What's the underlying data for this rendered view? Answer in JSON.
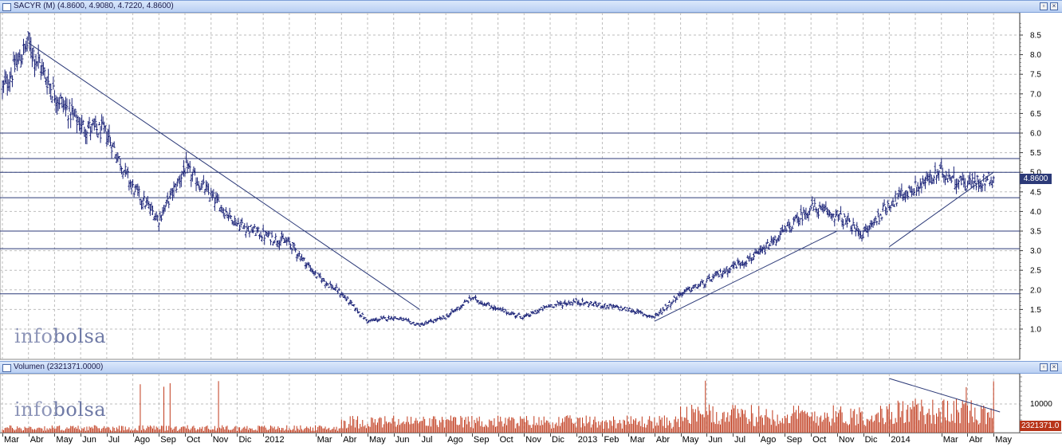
{
  "price_panel": {
    "title": "SACYR (M) (4.8600, 4.9080, 4.7220, 4.8600)",
    "last_value_label": "4.8600",
    "watermark_a": "info",
    "watermark_b": "bolsa"
  },
  "volume_panel": {
    "title": "Volumen (2321371.0000)",
    "last_value_label": "2321371.0",
    "axis_label": "10000",
    "watermark_a": "info",
    "watermark_b": "bolsa"
  },
  "colors": {
    "price_bars": "#1c2478",
    "volume_bars": "#c0391b",
    "horizontal_levels": "#2c3a78",
    "trendlines": "#2c3a78",
    "grid": "#bdbdbd",
    "panel_title_bg": "#c9dbf6"
  },
  "chart_data": [
    {
      "type": "ohlc",
      "title": "SACYR (M) (4.8600, 4.9080, 4.7220, 4.8600)",
      "y_ticks": [
        "1.0",
        "1.5",
        "2.0",
        "2.5",
        "3.0",
        "3.5",
        "4.0",
        "4.5",
        "5.0",
        "5.5",
        "6.0",
        "6.5",
        "7.0",
        "7.5",
        "8.0",
        "8.5"
      ],
      "ylim": [
        0.4,
        8.9
      ],
      "grid": true,
      "x_tick_labels": [
        "Mar",
        "Abr",
        "May",
        "Jun",
        "Jul",
        "Ago",
        "Sep",
        "Oct",
        "Nov",
        "Dic",
        "2012",
        "Mar",
        "Abr",
        "May",
        "Jun",
        "Jul",
        "Ago",
        "Sep",
        "Oct",
        "Nov",
        "Dic",
        "2013",
        "Feb",
        "Mar",
        "Abr",
        "May",
        "Jun",
        "Jul",
        "Ago",
        "Sep",
        "Oct",
        "Nov",
        "Dic",
        "2014",
        "Mar",
        "Abr",
        "May"
      ],
      "period": [
        "2011-03",
        "2014-05"
      ],
      "last": {
        "open": 4.86,
        "high": 4.908,
        "low": 4.722,
        "close": 4.86
      },
      "price_path": [
        {
          "date": "2011-03",
          "close": 7.1
        },
        {
          "date": "2011-04",
          "close": 8.3
        },
        {
          "date": "2011-05",
          "close": 7.0
        },
        {
          "date": "2011-06",
          "close": 6.2
        },
        {
          "date": "2011-07",
          "close": 6.0
        },
        {
          "date": "2011-08",
          "close": 4.6
        },
        {
          "date": "2011-09",
          "close": 3.8
        },
        {
          "date": "2011-10",
          "close": 5.1
        },
        {
          "date": "2011-11",
          "close": 4.4
        },
        {
          "date": "2011-12",
          "close": 3.7
        },
        {
          "date": "2012-01",
          "close": 3.4
        },
        {
          "date": "2012-02",
          "close": 3.2
        },
        {
          "date": "2012-03",
          "close": 2.4
        },
        {
          "date": "2012-04",
          "close": 1.9
        },
        {
          "date": "2012-05",
          "close": 1.2
        },
        {
          "date": "2012-06",
          "close": 1.3
        },
        {
          "date": "2012-07",
          "close": 1.1
        },
        {
          "date": "2012-08",
          "close": 1.3
        },
        {
          "date": "2012-09",
          "close": 1.8
        },
        {
          "date": "2012-10",
          "close": 1.5
        },
        {
          "date": "2012-11",
          "close": 1.3
        },
        {
          "date": "2012-12",
          "close": 1.6
        },
        {
          "date": "2013-01",
          "close": 1.7
        },
        {
          "date": "2013-02",
          "close": 1.6
        },
        {
          "date": "2013-03",
          "close": 1.5
        },
        {
          "date": "2013-04",
          "close": 1.3
        },
        {
          "date": "2013-05",
          "close": 1.9
        },
        {
          "date": "2013-06",
          "close": 2.2
        },
        {
          "date": "2013-07",
          "close": 2.6
        },
        {
          "date": "2013-08",
          "close": 2.9
        },
        {
          "date": "2013-09",
          "close": 3.5
        },
        {
          "date": "2013-10",
          "close": 4.1
        },
        {
          "date": "2013-11",
          "close": 3.9
        },
        {
          "date": "2013-12",
          "close": 3.4
        },
        {
          "date": "2014-01",
          "close": 4.2
        },
        {
          "date": "2014-02",
          "close": 4.6
        },
        {
          "date": "2014-03",
          "close": 5.0
        },
        {
          "date": "2014-04",
          "close": 4.7
        },
        {
          "date": "2014-05",
          "close": 4.86
        }
      ],
      "horizontal_levels": [
        1.9,
        3.05,
        3.5,
        4.35,
        5.0,
        5.35,
        6.0
      ],
      "trendlines": [
        {
          "from": {
            "date": "2011-04",
            "value": 8.3
          },
          "to": {
            "date": "2012-07",
            "value": 1.5
          }
        },
        {
          "from": {
            "date": "2013-04",
            "value": 1.2
          },
          "to": {
            "date": "2013-11",
            "value": 3.5
          }
        },
        {
          "from": {
            "date": "2014-01",
            "value": 3.1
          },
          "to": {
            "date": "2014-05",
            "value": 5.0
          }
        }
      ]
    },
    {
      "type": "bar",
      "title": "Volumen (2321371.0000)",
      "y_ticks": [
        "10000"
      ],
      "grid": true,
      "period": [
        "2011-03",
        "2014-05"
      ],
      "last_value": 2321371,
      "trendlines": [
        {
          "from": {
            "date": "2014-01"
          },
          "to": {
            "date": "2014-05"
          }
        }
      ]
    }
  ]
}
